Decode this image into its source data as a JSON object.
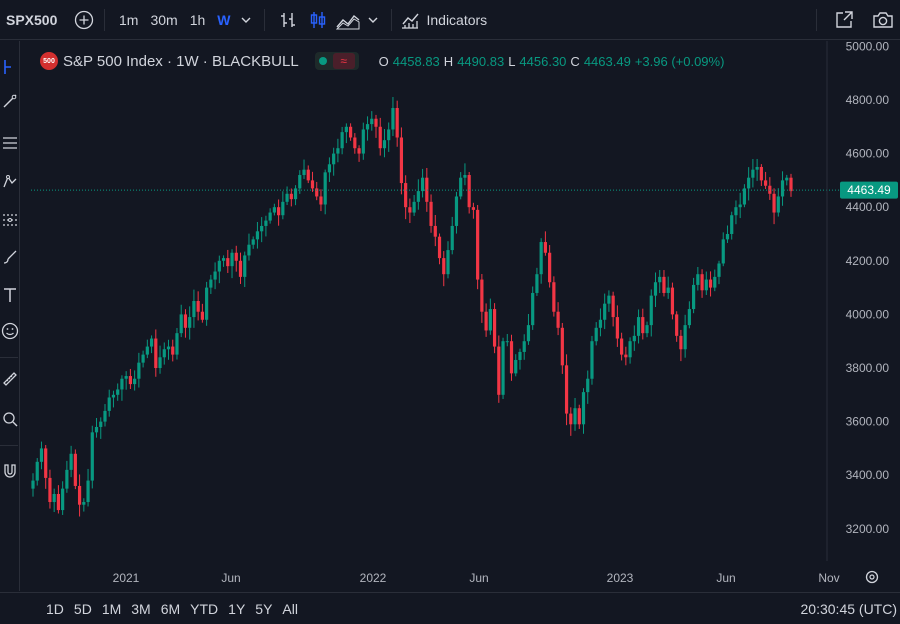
{
  "toolbar": {
    "symbol": "SPX500",
    "intervals": [
      "1m",
      "30m",
      "1h",
      "W"
    ],
    "active_interval": "W",
    "indicators_label": "Indicators"
  },
  "legend": {
    "logo_text": "500",
    "title": "S&P 500 Index · 1W · BLACKBULL",
    "open_label": "O",
    "open": "4458.83",
    "high_label": "H",
    "high": "4490.83",
    "low_label": "L",
    "low": "4456.30",
    "close_label": "C",
    "close": "4463.49",
    "change": "+3.96 (+0.09%)"
  },
  "price_tag": "4463.49",
  "bottom": {
    "ranges": [
      "1D",
      "5D",
      "1M",
      "3M",
      "6M",
      "YTD",
      "1Y",
      "5Y",
      "All"
    ],
    "clock": "20:30:45 (UTC)"
  },
  "colors": {
    "up": "#089981",
    "down": "#f23645",
    "background": "#131722",
    "accent": "#2962ff"
  },
  "icons": {
    "top": [
      "add-symbol-icon",
      "chevron-down-icon",
      "bar-style-icon",
      "candle-style-icon",
      "area-style-icon",
      "chevron-down-icon",
      "indicators-icon",
      "fullscreen-icon",
      "camera-icon"
    ],
    "left": [
      "cursor-icon",
      "trend-line-icon",
      "fib-icon",
      "pattern-icon",
      "projection-icon",
      "brush-icon",
      "text-icon",
      "emoji-icon",
      "ruler-icon",
      "zoom-icon",
      "magnet-icon"
    ]
  },
  "chart_data": {
    "type": "candlestick",
    "title": "S&P 500 Index · 1W · BLACKBULL",
    "x_ticks": [
      "2021",
      "Jun",
      "2022",
      "Jun",
      "2023",
      "Jun",
      "Nov"
    ],
    "y_ticks": [
      3200,
      3400,
      3600,
      3800,
      4000,
      4200,
      4400,
      4600,
      4800,
      5000
    ],
    "ylim": [
      3080,
      5020
    ],
    "last_price": 4463.49,
    "grid": false,
    "closes_weekly_approx": [
      3380,
      3450,
      3500,
      3390,
      3300,
      3330,
      3270,
      3350,
      3420,
      3480,
      3360,
      3290,
      3300,
      3380,
      3560,
      3580,
      3600,
      3640,
      3690,
      3700,
      3720,
      3760,
      3770,
      3740,
      3760,
      3820,
      3850,
      3880,
      3910,
      3800,
      3840,
      3870,
      3880,
      3850,
      3930,
      4000,
      3950,
      3990,
      4050,
      4010,
      3980,
      4100,
      4130,
      4160,
      4200,
      4210,
      4180,
      4230,
      4200,
      4140,
      4220,
      4260,
      4280,
      4310,
      4330,
      4350,
      4380,
      4400,
      4370,
      4420,
      4450,
      4430,
      4470,
      4520,
      4540,
      4500,
      4470,
      4440,
      4410,
      4530,
      4560,
      4600,
      4620,
      4680,
      4700,
      4660,
      4620,
      4600,
      4690,
      4710,
      4730,
      4700,
      4620,
      4650,
      4690,
      4770,
      4660,
      4490,
      4400,
      4380,
      4420,
      4460,
      4510,
      4420,
      4330,
      4290,
      4210,
      4150,
      4240,
      4330,
      4440,
      4510,
      4520,
      4400,
      4390,
      4130,
      4010,
      3940,
      4020,
      3880,
      3700,
      3900,
      3900,
      3780,
      3830,
      3860,
      3900,
      3960,
      4080,
      4150,
      4270,
      4230,
      4120,
      4010,
      3950,
      3810,
      3630,
      3590,
      3650,
      3590,
      3710,
      3760,
      3900,
      3950,
      3980,
      4040,
      4070,
      3990,
      3910,
      3850,
      3840,
      3900,
      3920,
      3990,
      3930,
      3960,
      4070,
      4120,
      4140,
      4080,
      4100,
      4000,
      3920,
      3870,
      3960,
      4020,
      4110,
      4150,
      4090,
      4130,
      4100,
      4140,
      4190,
      4280,
      4300,
      4370,
      4400,
      4410,
      4470,
      4510,
      4540,
      4550,
      4500,
      4480,
      4450,
      4380,
      4440,
      4500,
      4510,
      4460
    ]
  }
}
